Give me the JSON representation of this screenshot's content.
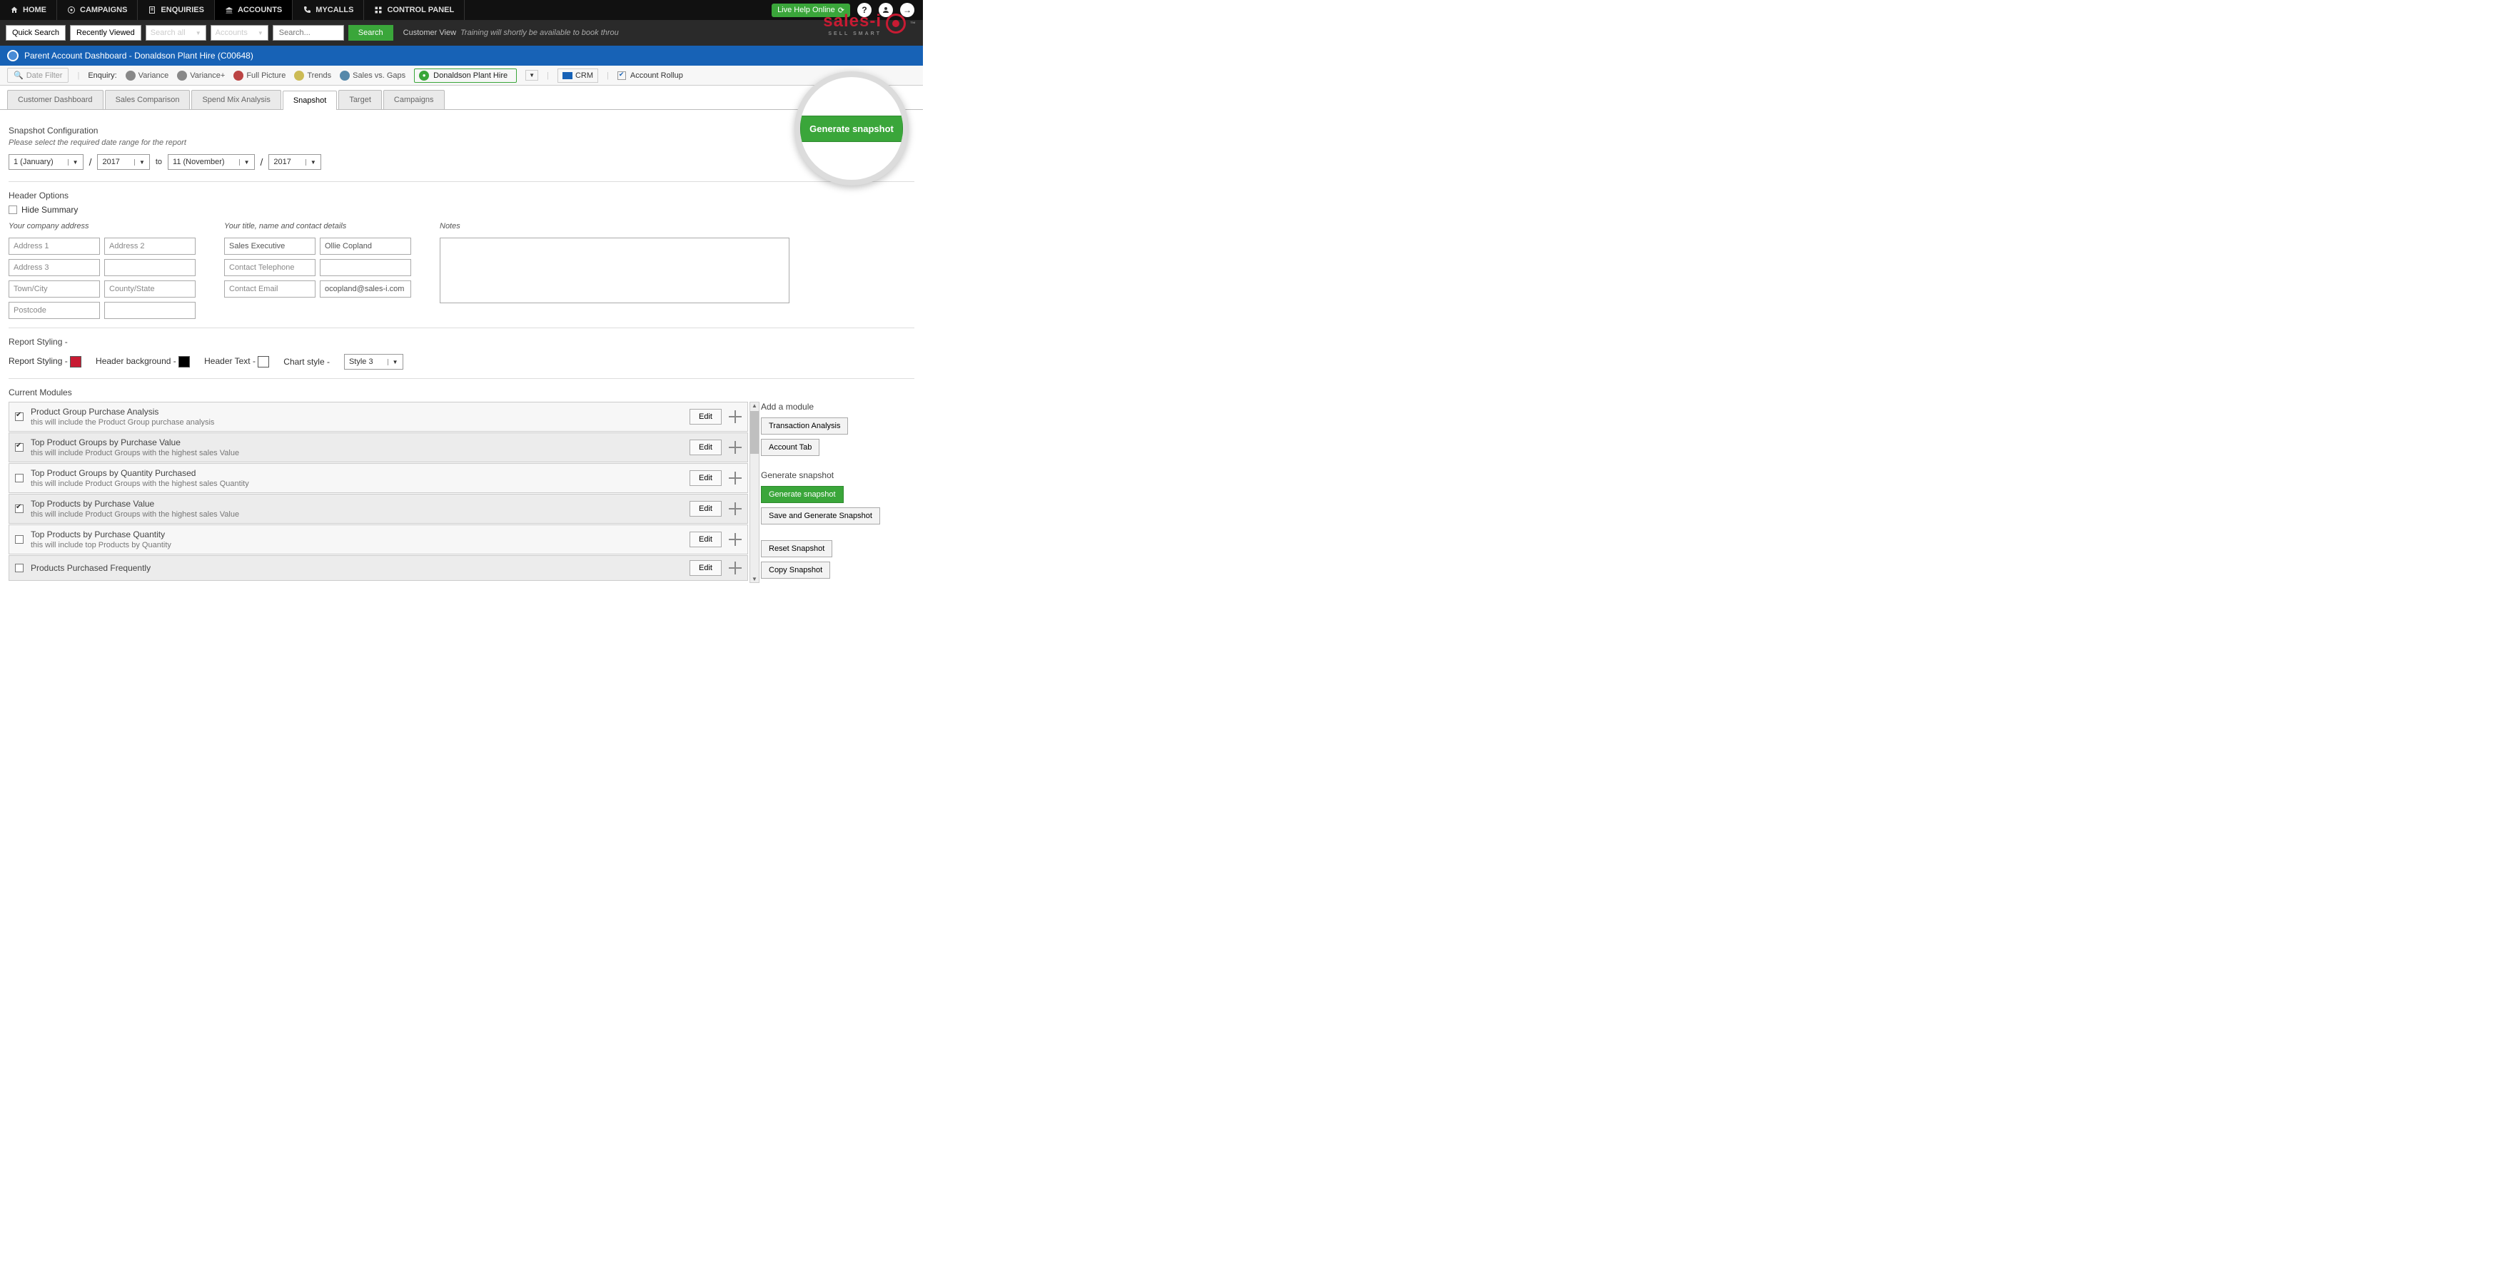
{
  "nav": {
    "home": "HOME",
    "campaigns": "CAMPAIGNS",
    "enquiries": "ENQUIRIES",
    "accounts": "ACCOUNTS",
    "mycalls": "MYCALLS",
    "control_panel": "CONTROL PANEL",
    "live_help": "Live Help Online"
  },
  "toolbar": {
    "quick_search": "Quick Search",
    "recently_viewed": "Recently Viewed",
    "search_all": "Search all",
    "accounts": "Accounts",
    "search_placeholder": "Search...",
    "search_btn": "Search",
    "customer_view": "Customer View",
    "training": "Training will shortly be available to book throu"
  },
  "bluebar": {
    "title": "Parent Account Dashboard - Donaldson Plant Hire (C00648)"
  },
  "enquiry": {
    "date_filter": "Date Filter",
    "label": "Enquiry:",
    "variance": "Variance",
    "variance_plus": "Variance+",
    "full_picture": "Full Picture",
    "trends": "Trends",
    "sales_vs_gaps": "Sales vs. Gaps",
    "account_name": "Donaldson Plant Hire",
    "crm": "CRM",
    "rollup": "Account Rollup"
  },
  "tabs": {
    "customer_dashboard": "Customer Dashboard",
    "sales_comparison": "Sales Comparison",
    "spend_mix": "Spend Mix Analysis",
    "snapshot": "Snapshot",
    "target": "Target",
    "campaigns": "Campaigns"
  },
  "snapshot": {
    "config_title": "Snapshot Configuration",
    "date_hint": "Please select the required date range for the report",
    "from_month": "1 (January)",
    "from_year": "2017",
    "to_label": "to",
    "to_month": "11 (November)",
    "to_year": "2017",
    "header_options": "Header Options",
    "hide_summary": "Hide Summary",
    "company_address_label": "Your company address",
    "addr1": "Address 1",
    "addr2": "Address 2",
    "addr3": "Address 3",
    "town": "Town/City",
    "county": "County/State",
    "postcode": "Postcode",
    "contact_label": "Your title, name and contact details",
    "job_title": "Sales Executive",
    "name": "Ollie Copland",
    "telephone": "Contact Telephone",
    "email_label": "Contact Email",
    "email_value": "ocopland@sales-i.com",
    "notes_label": "Notes",
    "report_styling_title": "Report Styling -",
    "report_styling": "Report Styling -",
    "header_bg": "Header background -",
    "header_text": "Header Text -",
    "chart_style": "Chart style -",
    "chart_style_value": "Style 3",
    "current_modules": "Current Modules"
  },
  "modules": [
    {
      "title": "Product Group Purchase Analysis",
      "desc": "this will include the Product Group purchase analysis",
      "checked": true,
      "alt": false
    },
    {
      "title": "Top Product Groups by Purchase Value",
      "desc": "this will include Product Groups with the highest sales Value",
      "checked": true,
      "alt": true
    },
    {
      "title": "Top Product Groups by Quantity Purchased",
      "desc": "this will include Product Groups with the highest sales Quantity",
      "checked": false,
      "alt": false
    },
    {
      "title": "Top Products by Purchase Value",
      "desc": "this will include Product Groups with the highest sales Value",
      "checked": true,
      "alt": true
    },
    {
      "title": "Top Products by Purchase Quantity",
      "desc": "this will include top Products by Quantity",
      "checked": false,
      "alt": false
    },
    {
      "title": "Products Purchased Frequently",
      "desc": "",
      "checked": false,
      "alt": true
    }
  ],
  "edit_label": "Edit",
  "side": {
    "add_module": "Add a module",
    "transaction_analysis": "Transaction Analysis",
    "account_tab": "Account Tab",
    "generate_title": "Generate snapshot",
    "generate_btn": "Generate snapshot",
    "save_generate": "Save and Generate Snapshot",
    "reset": "Reset Snapshot",
    "copy": "Copy Snapshot"
  },
  "magnifier": {
    "button": "Generate snapshot"
  },
  "logo": {
    "text": "sales-i",
    "sub": "SELL SMART"
  }
}
